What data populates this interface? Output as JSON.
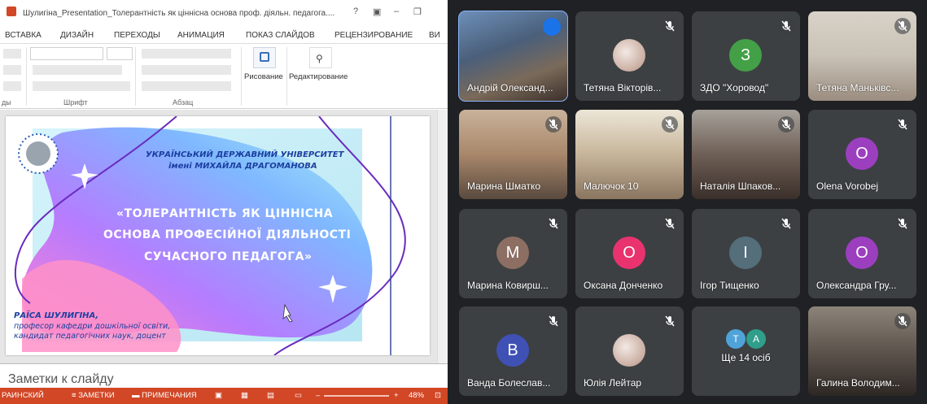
{
  "ppt": {
    "title": "Шулигіна_Presentation_Толерантність як ціннісна основа проф. діяльн. педагога....",
    "titlebar_buttons": [
      "?",
      "▣",
      "–",
      "❐"
    ],
    "tabs": [
      "ВСТАВКА",
      "ДИЗАЙН",
      "ПЕРЕХОДЫ",
      "АНИМАЦИЯ",
      "ПОКАЗ СЛАЙДОВ",
      "РЕЦЕНЗИРОВАНИЕ",
      "ВИ"
    ],
    "groups": {
      "slides": "ды",
      "font": "Шрифт",
      "paragraph": "Абзац"
    },
    "drawing_label": "Рисование",
    "editing_label": "Редактирование",
    "notes_placeholder": "Заметки к слайду",
    "status": {
      "language": "РАИНСКИЙ",
      "notes": "ЗАМЕТКИ",
      "comments": "ПРИМЕЧАНИЯ",
      "zoom": "48%"
    },
    "slide": {
      "university_line1": "УКРАЇНСЬКИЙ ДЕРЖАВНИЙ УНІВЕРСИТЕТ",
      "university_line2": "імені МИХАЙЛА ДРАГОМАНОВА",
      "title_line1": "«ТОЛЕРАНТНІСТЬ ЯК ЦІННІСНА",
      "title_line2": "ОСНОВА ПРОФЕСІЙНОЇ ДІЯЛЬНОСТІ",
      "title_line3": "СУЧАСНОГО ПЕДАГОГА»",
      "author_name": "РАЇСА ШУЛИГІНА,",
      "author_line2": "професор кафедри дошкільної освіти,",
      "author_line3": "кандидат педагогічних наук, доцент"
    }
  },
  "meet": {
    "participants": [
      {
        "name": "Андрій Олександ...",
        "type": "video",
        "active": true
      },
      {
        "name": "Тетяна Вікторів...",
        "type": "photo"
      },
      {
        "name": "ЗДО \"Хоровод\"",
        "type": "avatar",
        "initial": "З",
        "color": "#43a047"
      },
      {
        "name": "Тетяна Маньківс...",
        "type": "video"
      },
      {
        "name": "Марина Шматко",
        "type": "video"
      },
      {
        "name": "Малючок 10",
        "type": "video"
      },
      {
        "name": "Наталія Шпаков...",
        "type": "video"
      },
      {
        "name": "Olena Vorobej",
        "type": "avatar",
        "initial": "O",
        "color": "#9c3fbf"
      },
      {
        "name": "Марина Ковирш...",
        "type": "avatar",
        "initial": "M",
        "color": "#8d6e63"
      },
      {
        "name": "Оксана Донченко",
        "type": "avatar",
        "initial": "O",
        "color": "#e8336f"
      },
      {
        "name": "Ігор Тищенко",
        "type": "avatar",
        "initial": "I",
        "color": "#546e7a"
      },
      {
        "name": "Олександра Гру...",
        "type": "avatar",
        "initial": "O",
        "color": "#9c3fbf"
      },
      {
        "name": "Ванда Болеслав...",
        "type": "avatar",
        "initial": "B",
        "color": "#3f51b5"
      },
      {
        "name": "Юлія Лейтар",
        "type": "photo"
      },
      {
        "name": "Ще 14 осіб",
        "type": "more",
        "initials": [
          "T",
          "A"
        ]
      },
      {
        "name": "Галина Володим...",
        "type": "video"
      }
    ]
  }
}
